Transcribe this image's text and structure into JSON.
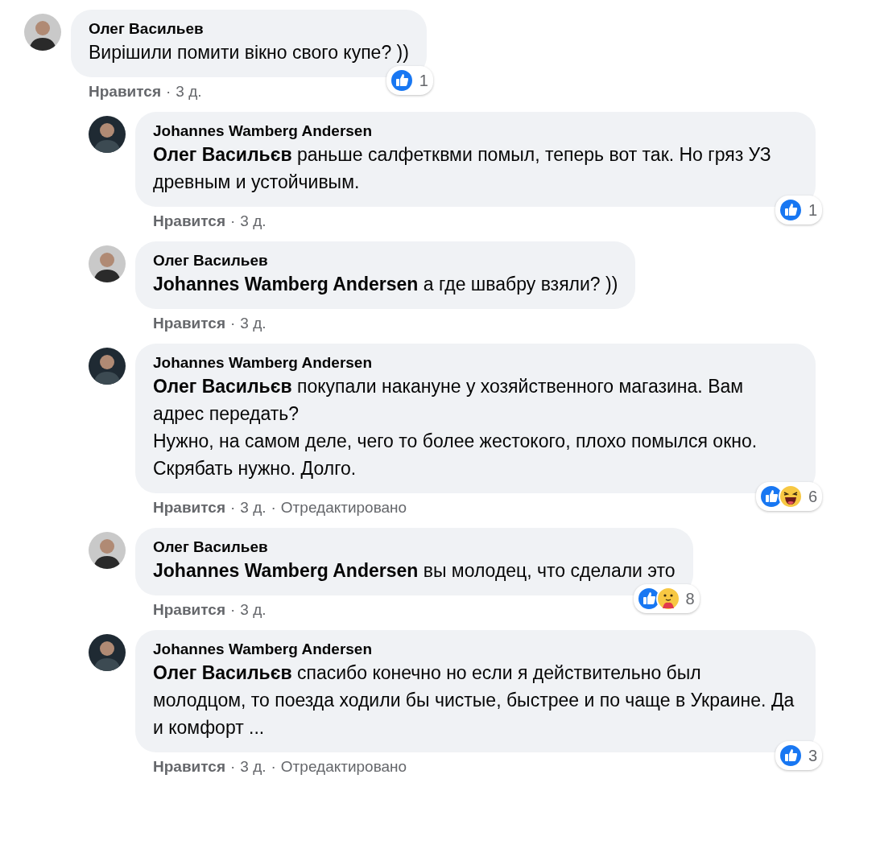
{
  "comments": [
    {
      "reply": false,
      "author": "Олег Васильев",
      "paragraphs": [
        "Вирішили помити вікно свого купе? ))"
      ],
      "reactions": [
        {
          "kind": "like"
        }
      ],
      "count": "1",
      "meta": [
        "Нравится",
        "·",
        "3 д."
      ]
    },
    {
      "reply": true,
      "author": "Johannes Wamberg Andersen",
      "paragraphs": [
        "**Олег Васильєв** раньше салфетквми помыл, теперь вот так. Но гряз УЗ древным и устойчивым."
      ],
      "reactions": [
        {
          "kind": "like"
        }
      ],
      "count": "1",
      "meta": [
        "Нравится",
        "·",
        "3 д."
      ]
    },
    {
      "reply": true,
      "author": "Олег Васильев",
      "paragraphs": [
        "**Johannes Wamberg Andersen** а где швабру взяли? ))"
      ],
      "meta": [
        "Нравится",
        "·",
        "3 д."
      ]
    },
    {
      "reply": true,
      "author": "Johannes Wamberg Andersen",
      "paragraphs": [
        "**Олег Васильєв** покупали накануне у хозяйственного магазина. Вам адрес передать?",
        "Нужно, на самом деле, чего то более жестокого, плохо помылся окно.",
        "Скрябать нужно. Долго."
      ],
      "reactions": [
        {
          "kind": "like"
        },
        {
          "kind": "haha"
        }
      ],
      "count": "6",
      "meta": [
        "Нравится",
        "·",
        "3 д.",
        "·",
        "Отредактировано"
      ]
    },
    {
      "reply": true,
      "author": "Олег Васильев",
      "paragraphs": [
        "**Johannes Wamberg Andersen** вы молодец, что сделали это"
      ],
      "reactions": [
        {
          "kind": "like"
        },
        {
          "kind": "care"
        }
      ],
      "count": "8",
      "meta": [
        "Нравится",
        "·",
        "3 д."
      ]
    },
    {
      "reply": true,
      "author": "Johannes Wamberg Andersen",
      "paragraphs": [
        "**Олег Васильєв** спасибо конечно но если я действительно был молодцом, то поезда ходили бы чистые, быстрее и по чаще в Украине. Да и комфорт ..."
      ],
      "reactions": [
        {
          "kind": "like"
        }
      ],
      "count": "3",
      "meta": [
        "Нравится",
        "·",
        "3 д.",
        "·",
        "Отредактировано"
      ]
    }
  ]
}
